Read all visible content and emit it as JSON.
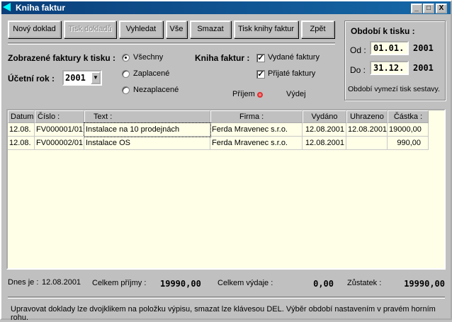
{
  "window": {
    "title": "Kniha faktur",
    "minimize": "_",
    "maximize": "□",
    "close": "X"
  },
  "toolbar": {
    "new": "Nový doklad",
    "print_docs": "Tisk dokladů",
    "search": "Vyhledat",
    "all": "Vše",
    "delete": "Smazat",
    "print_book": "Tisk knihy faktur",
    "back": "Zpět"
  },
  "filters": {
    "shown_label": "Zobrazené faktury k tisku :",
    "options": [
      "Všechny",
      "Zaplacené",
      "Nezaplacené"
    ],
    "selected": "Všechny",
    "year_label": "Účetní rok :",
    "year": "2001",
    "book_label": "Kniha faktur :",
    "issued": "Vydané faktury",
    "received": "Přijaté faktury",
    "income": "Příjem",
    "expense": "Výdej"
  },
  "period": {
    "title": "Období k tisku :",
    "from_label": "Od :",
    "from": "01.01.",
    "from_year": "2001",
    "to_label": "Do :",
    "to": "31.12.",
    "to_year": "2001",
    "note": "Období vymezí tisk sestavy."
  },
  "table": {
    "columns": [
      "Datum",
      "Číslo :",
      "Text :",
      "Firma :",
      "Vydáno",
      "Uhrazeno",
      "Částka :"
    ],
    "rows": [
      [
        "12.08.",
        "FV000001/01",
        "Instalace na 10 prodejnách",
        "Ferda Mravenec s.r.o.",
        "12.08.2001",
        "12.08.2001",
        "19000,00"
      ],
      [
        "12.08.",
        "FV000002/01",
        "Instalace OS",
        "Ferda Mravenec s.r.o.",
        "12.08.2001",
        "",
        "990,00"
      ]
    ]
  },
  "summary": {
    "today_label": "Dnes je :",
    "today": "12.08.2001",
    "income_label": "Celkem příjmy :",
    "income": "19990,00",
    "expense_label": "Celkem výdaje :",
    "expense": "0,00",
    "balance_label": "Zůstatek :",
    "balance": "19990,00"
  },
  "status": "Upravovat doklady lze dvojklikem na položku výpisu, smazat lze klávesou DEL. Výběr období nastavením v pravém horním rohu."
}
